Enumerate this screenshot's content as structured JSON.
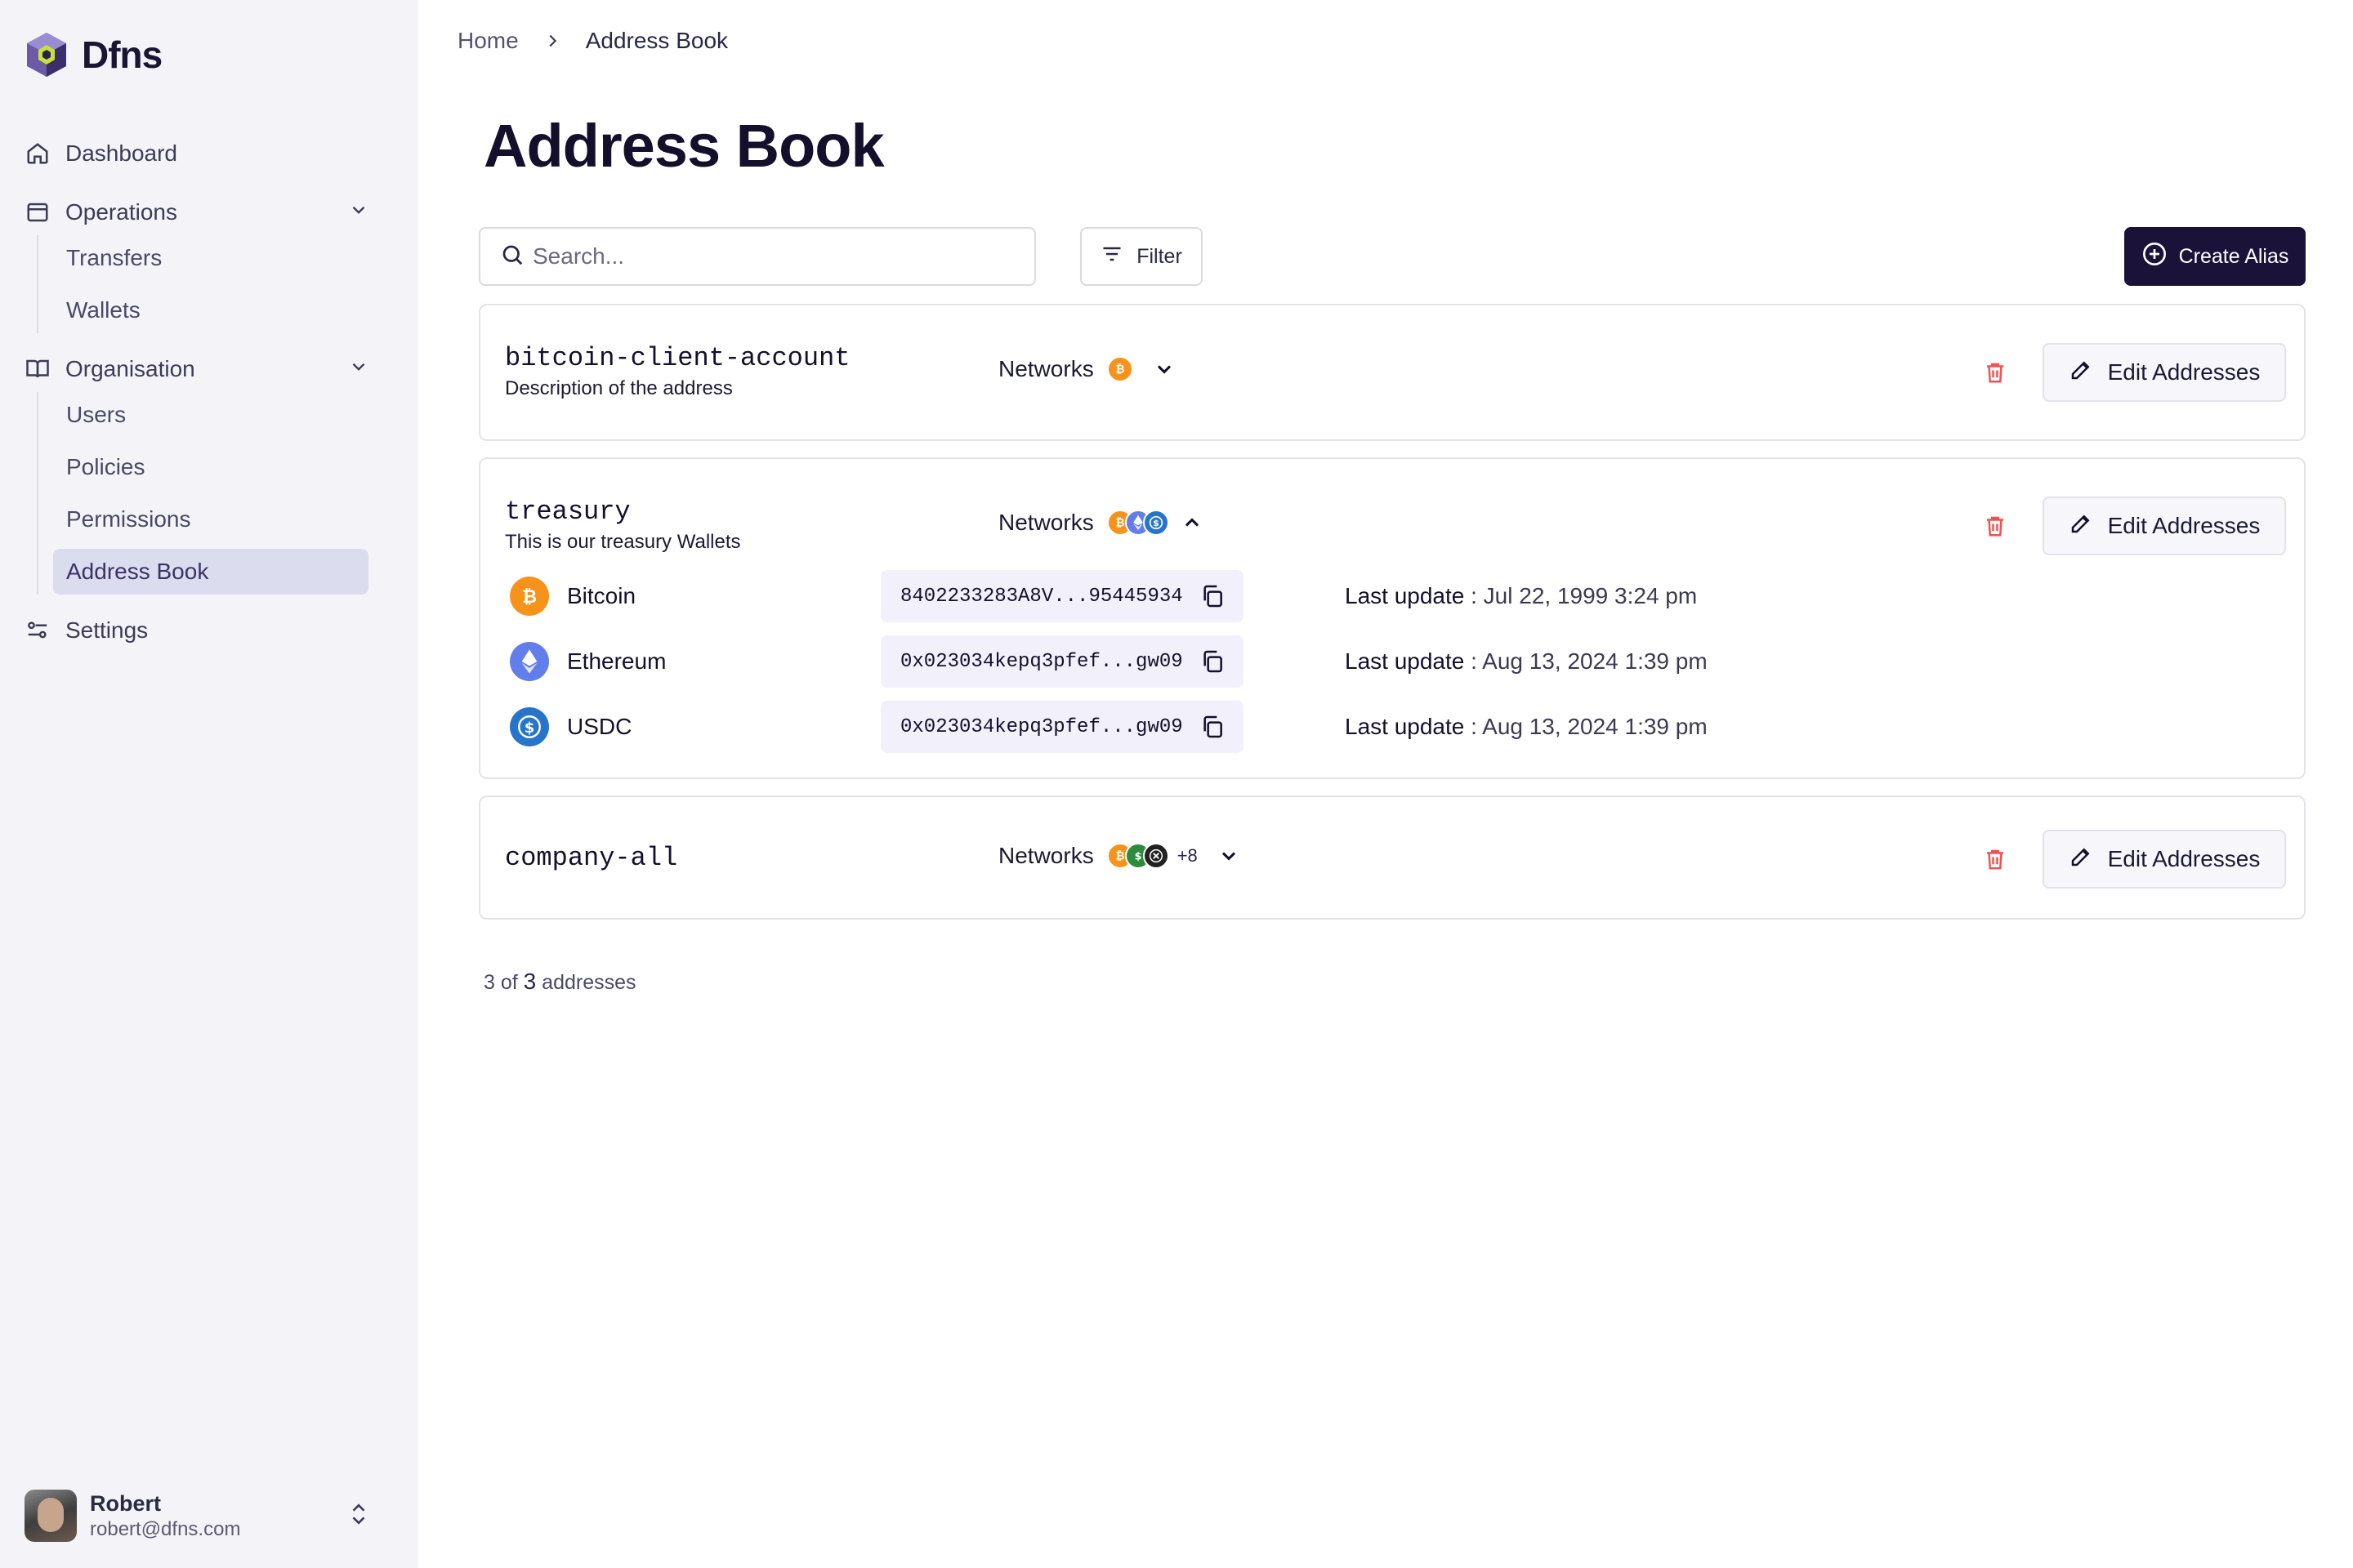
{
  "app": {
    "name": "Dfns"
  },
  "sidebar": {
    "items": [
      {
        "label": "Dashboard"
      },
      {
        "label": "Operations"
      },
      {
        "label": "Organisation"
      },
      {
        "label": "Settings"
      }
    ],
    "operations_children": [
      {
        "label": "Transfers"
      },
      {
        "label": "Wallets"
      }
    ],
    "organisation_children": [
      {
        "label": "Users"
      },
      {
        "label": "Policies"
      },
      {
        "label": "Permissions"
      },
      {
        "label": "Address Book"
      }
    ],
    "user": {
      "name": "Robert",
      "email": "robert@dfns.com"
    }
  },
  "breadcrumb": {
    "home": "Home",
    "current": "Address Book"
  },
  "page": {
    "title": "Address Book"
  },
  "toolbar": {
    "search_placeholder": "Search...",
    "filter_label": "Filter",
    "create_label": "Create Alias"
  },
  "colors": {
    "primary": "#1a1238",
    "bitcoin": "#f7931a",
    "ethereum": "#627eea",
    "usdc": "#2775ca",
    "danger": "#f05252",
    "active_nav": "#dcdcef"
  },
  "aliases": [
    {
      "alias": "bitcoin-client-account",
      "description": "Description of the address",
      "networks_label": "Networks",
      "edit_label": "Edit Addresses"
    },
    {
      "alias": "treasury",
      "description": "This is our treasury Wallets",
      "networks_label": "Networks",
      "edit_label": "Edit Addresses",
      "addresses": [
        {
          "network": "Bitcoin",
          "address": "8402233283A8V...95445934",
          "last_update_label": "Last update",
          "last_update": " : Jul 22, 1999 3:24 pm"
        },
        {
          "network": "Ethereum",
          "address": "0x023034kepq3pfef...gw09",
          "last_update_label": "Last update",
          "last_update": " : Aug 13, 2024 1:39 pm"
        },
        {
          "network": "USDC",
          "address": "0x023034kepq3pfef...gw09",
          "last_update_label": "Last update",
          "last_update": " : Aug 13, 2024 1:39 pm"
        }
      ]
    },
    {
      "alias": "company-all",
      "networks_label": "Networks",
      "more_count": "+8",
      "edit_label": "Edit Addresses"
    }
  ],
  "footer": {
    "count_prefix": "3 of ",
    "count_total": "3",
    "count_suffix": " addresses"
  }
}
